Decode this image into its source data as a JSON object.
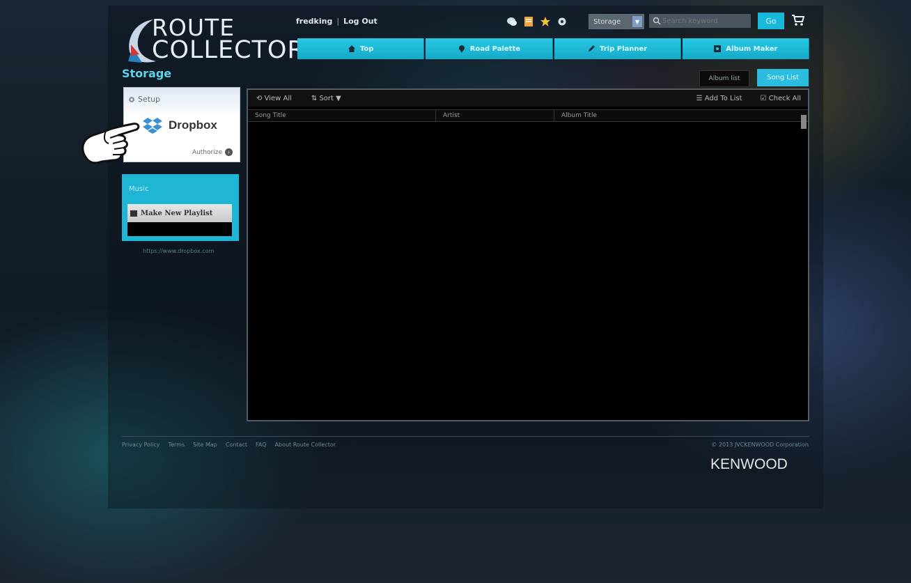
{
  "app": {
    "logo_line1": "ROUTE",
    "logo_line2": "COLLECTOR",
    "page_title": "Storage"
  },
  "header": {
    "user_name": "fredking",
    "logout_label": "Log Out",
    "storage_select_value": "Storage",
    "search_placeholder": "Search keyword",
    "go_label": "Go",
    "icons": [
      "chat-icon",
      "note-icon",
      "star-icon",
      "gear-icon",
      "cart-icon"
    ]
  },
  "nav": {
    "tabs": [
      {
        "label": "Top",
        "icon": "home-icon"
      },
      {
        "label": "Road Palette",
        "icon": "pin-icon"
      },
      {
        "label": "Trip Planner",
        "icon": "pen-icon"
      },
      {
        "label": "Album Maker",
        "icon": "album-icon"
      }
    ]
  },
  "view_toggle": {
    "album_list": "Album list",
    "song_list": "Song List"
  },
  "setup": {
    "title": "Setup",
    "provider": "Dropbox",
    "authorize": "Authorize"
  },
  "music": {
    "title": "Music",
    "make_playlist": "Make New Playlist"
  },
  "dropbox_url": "https://www.dropbox.com",
  "toolbar": {
    "view_all": "View All",
    "sort": "Sort",
    "add_to_list": "Add To List",
    "check_all": "Check All"
  },
  "table": {
    "columns": [
      "Song Title",
      "Artist",
      "Album Title"
    ]
  },
  "footer": {
    "links": [
      "Privacy Policy",
      "Terms",
      "Site Map",
      "Contact",
      "FAQ",
      "About Route Collector"
    ],
    "copyright": "© 2013 JVCKENWOOD Corporation",
    "brand": "KENWOOD"
  },
  "colors": {
    "accent": "#1fb5d5",
    "panel": "#000000"
  }
}
